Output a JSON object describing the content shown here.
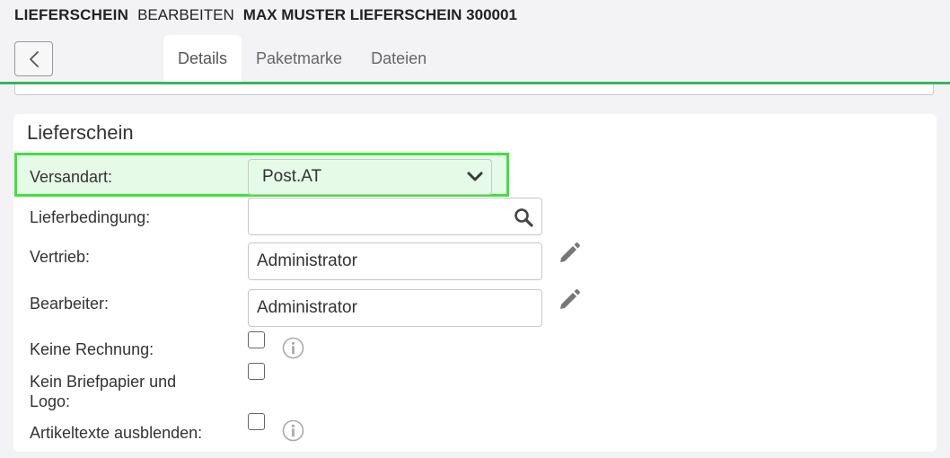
{
  "header": {
    "doc_type": "LIEFERSCHEIN",
    "mode": "BEARBEITEN",
    "doc_name": "MAX MUSTER LIEFERSCHEIN 300001"
  },
  "back_button": {
    "icon": "chevron-left-icon"
  },
  "tabs": [
    {
      "label": "Details",
      "active": true
    },
    {
      "label": "Paketmarke",
      "active": false
    },
    {
      "label": "Dateien",
      "active": false
    }
  ],
  "section": {
    "title": "Lieferschein",
    "fields": {
      "versandart": {
        "label": "Versandart:",
        "value": "Post.AT"
      },
      "lieferbedingung": {
        "label": "Lieferbedingung:",
        "value": ""
      },
      "vertrieb": {
        "label": "Vertrieb:",
        "value": "Administrator"
      },
      "bearbeiter": {
        "label": "Bearbeiter:",
        "value": "Administrator"
      },
      "keine_rechnung": {
        "label": "Keine Rechnung:",
        "checked": false
      },
      "kein_briefpapier": {
        "label_line1": "Kein Briefpapier und",
        "label_line2": "Logo:",
        "checked": false
      },
      "artikeltexte": {
        "label": "Artikeltexte ausblenden:",
        "checked": false
      }
    }
  },
  "colors": {
    "accent_green": "#37b55f",
    "highlight_border": "#3fe13f",
    "highlight_fill": "#e6fbe7"
  }
}
